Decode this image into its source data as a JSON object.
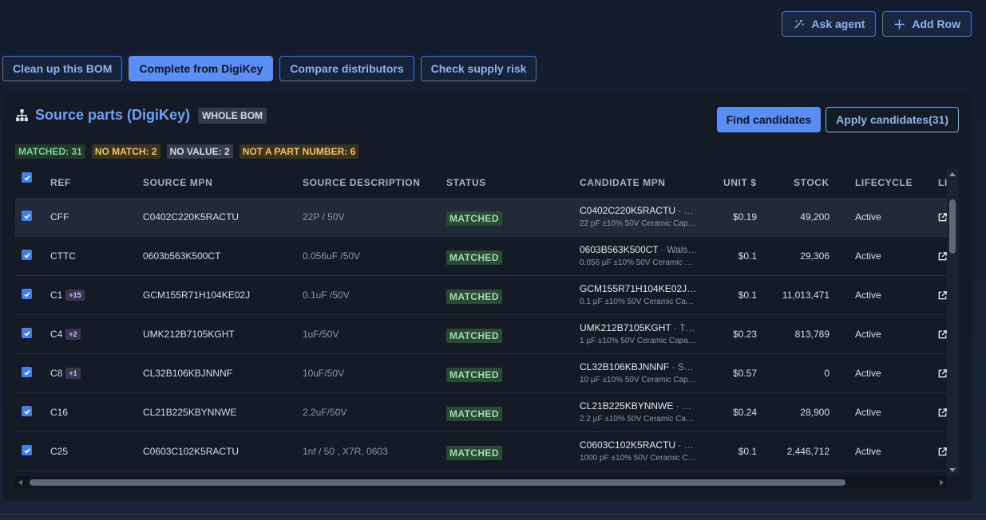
{
  "toolbar": {
    "ask_agent": "Ask agent",
    "add_row": "Add Row"
  },
  "quick_actions": [
    {
      "label": "Clean up this BOM",
      "active": false
    },
    {
      "label": "Complete from DigiKey",
      "active": true
    },
    {
      "label": "Compare distributors",
      "active": false
    },
    {
      "label": "Check supply risk",
      "active": false
    }
  ],
  "panel": {
    "title": "Source parts (DigiKey)",
    "scope_badge": "WHOLE BOM",
    "find_candidates": "Find candidates",
    "apply_candidates": "Apply candidates(31)"
  },
  "stats": {
    "matched": "MATCHED: 31",
    "no_match": "NO MATCH: 2",
    "no_value": "NO VALUE: 2",
    "not_part": "NOT A PART NUMBER: 6"
  },
  "columns": {
    "ref": "REF",
    "source_mpn": "SOURCE MPN",
    "source_desc": "SOURCE DESCRIPTION",
    "status": "STATUS",
    "candidate_mpn": "CANDIDATE MPN",
    "unit": "UNIT $",
    "stock": "STOCK",
    "lifecycle": "LIFECYCLE",
    "link": "LI"
  },
  "rows": [
    {
      "ref": "CFF",
      "ref_extra": "",
      "mpn": "C0402C220K5RACTU",
      "desc": "22P / 50V",
      "status": "MATCHED",
      "cand_mpn": "C0402C220K5RACTU",
      "cand_mfr": " · …",
      "cand_desc": "22 pF ±10% 50V Ceramic Capa…",
      "unit": "$0.19",
      "stock": "49,200",
      "lifecycle": "Active"
    },
    {
      "ref": "CTTC",
      "ref_extra": "",
      "mpn": "0603b563K500CT",
      "desc": "0.056uF /50V",
      "status": "MATCHED",
      "cand_mpn": "0603B563K500CT",
      "cand_mfr": " · Wals…",
      "cand_desc": "0.056 µF ±10% 50V Ceramic …",
      "unit": "$0.1",
      "stock": "29,306",
      "lifecycle": "Active"
    },
    {
      "ref": "C1",
      "ref_extra": "+15",
      "mpn": "GCM155R71H104KE02J",
      "desc": "0.1uF /50V",
      "status": "MATCHED",
      "cand_mpn": "GCM155R71H104KE02J…",
      "cand_mfr": "",
      "cand_desc": "0.1 µF ±10% 50V Ceramic Cap…",
      "unit": "$0.1",
      "stock": "11,013,471",
      "lifecycle": "Active"
    },
    {
      "ref": "C4",
      "ref_extra": "+2",
      "mpn": "UMK212B7105KGHT",
      "desc": "1uF/50V",
      "status": "MATCHED",
      "cand_mpn": "UMK212B7105KGHT",
      "cand_mfr": " · T…",
      "cand_desc": "1 µF ±10% 50V Ceramic Capa…",
      "unit": "$0.23",
      "stock": "813,789",
      "lifecycle": "Active"
    },
    {
      "ref": "C8",
      "ref_extra": "+1",
      "mpn": "CL32B106KBJNNNF",
      "desc": "10uF/50V",
      "status": "MATCHED",
      "cand_mpn": "CL32B106KBJNNNF",
      "cand_mfr": " · S…",
      "cand_desc": "10 µF ±10% 50V Ceramic Cap…",
      "unit": "$0.57",
      "stock": "0",
      "lifecycle": "Active"
    },
    {
      "ref": "C16",
      "ref_extra": "",
      "mpn": "CL21B225KBYNNWE",
      "desc": "2.2uF/50V",
      "status": "MATCHED",
      "cand_mpn": "CL21B225KBYNNWE",
      "cand_mfr": " · …",
      "cand_desc": "2.2 µF ±10% 50V Ceramic Ca…",
      "unit": "$0.24",
      "stock": "28,900",
      "lifecycle": "Active"
    },
    {
      "ref": "C25",
      "ref_extra": "",
      "mpn": "C0603C102K5RACTU",
      "desc": "1nf / 50 , X7R, 0603",
      "status": "MATCHED",
      "cand_mpn": "C0603C102K5RACTU",
      "cand_mfr": " · …",
      "cand_desc": "1000 pF ±10% 50V Ceramic C…",
      "unit": "$0.1",
      "stock": "2,446,712",
      "lifecycle": "Active"
    }
  ],
  "icons": {
    "ask_agent": "wand-icon",
    "add_row": "plus-icon",
    "panel": "hierarchy-icon",
    "row_link": "external-link-icon",
    "checkbox": "check-icon"
  },
  "colors": {
    "accent": "#5b8ef5",
    "matched_bg": "#2b4a36",
    "matched_fg": "#9fdcb0",
    "warn": "#f0c46a"
  }
}
